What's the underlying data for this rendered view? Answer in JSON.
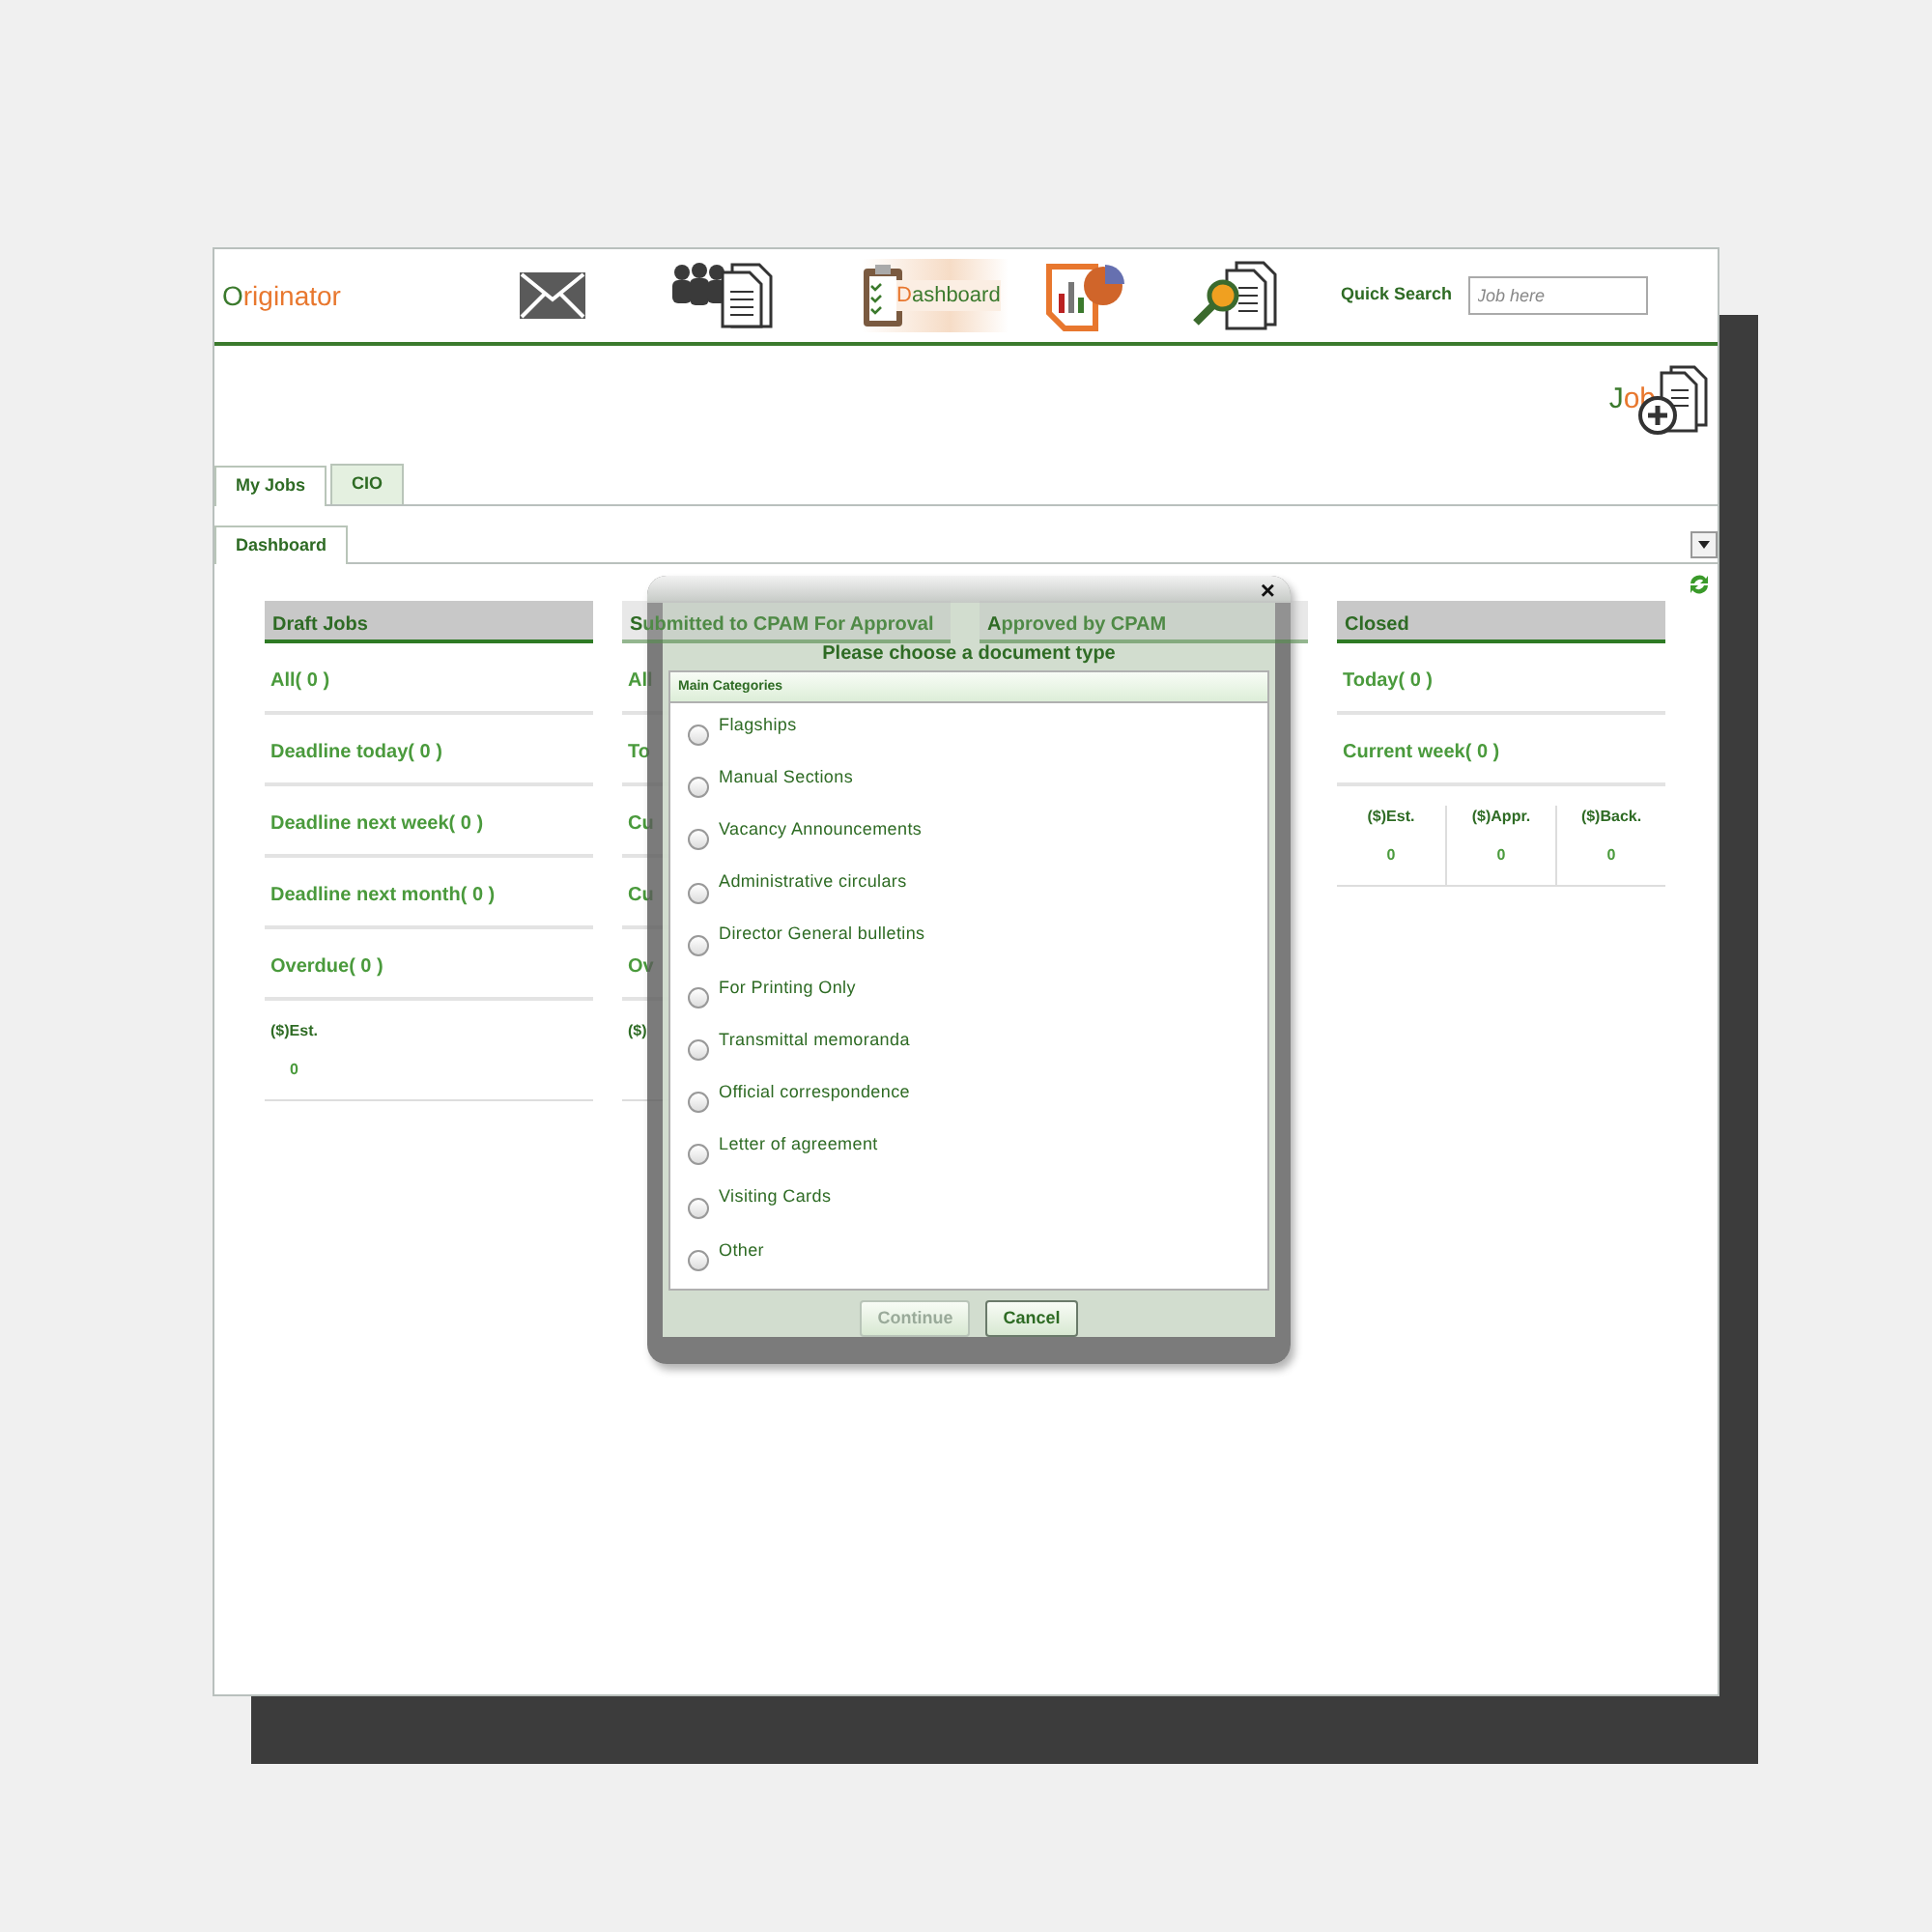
{
  "header": {
    "logo": "Originator",
    "nav": [
      {
        "kind": "mail"
      },
      {
        "kind": "people"
      },
      {
        "kind": "dashboard",
        "label": "Dashboard"
      },
      {
        "kind": "chart"
      },
      {
        "kind": "search"
      }
    ],
    "quick_search": {
      "label": "Quick Search",
      "placeholder": "Job here"
    }
  },
  "new_job": {
    "label": "Job"
  },
  "tabs": [
    {
      "label": "My Jobs",
      "selected": true
    },
    {
      "label": "CIO",
      "selected": false
    }
  ],
  "subtabs": [
    {
      "label": "Dashboard",
      "selected": true
    }
  ],
  "columns": [
    {
      "title": "Draft Jobs",
      "items": [
        "All( 0 )",
        "Deadline today( 0 )",
        "Deadline next week( 0 )",
        "Deadline next month( 0 )",
        "Overdue( 0 )"
      ],
      "stats": [
        {
          "label": "($)Est.",
          "value": "0"
        }
      ]
    },
    {
      "title": "Submitted to CPAM For Approval",
      "items": [
        "All",
        "To",
        "Cu",
        "Cu",
        "Ov"
      ],
      "stats": [
        {
          "label": "($)"
        }
      ]
    },
    {
      "title": "Approved by CPAM"
    },
    {
      "title": "Closed",
      "items": [
        "Today( 0 )",
        "Current week( 0 )"
      ],
      "stats": [
        {
          "label": "($)Est.",
          "value": "0"
        },
        {
          "label": "($)Appr.",
          "value": "0"
        },
        {
          "label": "($)Back.",
          "value": "0"
        }
      ]
    }
  ],
  "dialog": {
    "title": "Please choose a document type",
    "close": "×",
    "group": "Main Categories",
    "options": [
      {
        "label": "Flagships",
        "selected": false
      },
      {
        "label": "Manual Sections",
        "selected": false
      },
      {
        "label": "Vacancy Announcements",
        "selected": false
      },
      {
        "label": "Administrative circulars",
        "selected": false
      },
      {
        "label": "Director General bulletins",
        "selected": false
      },
      {
        "label": "For Printing Only",
        "selected": false
      },
      {
        "label": "Transmittal memoranda",
        "selected": false
      },
      {
        "label": "Official correspondence",
        "selected": false
      },
      {
        "label": "Letter of agreement",
        "selected": false
      },
      {
        "label": "Visiting Cards",
        "selected": false
      },
      {
        "label": "Other",
        "selected": false
      }
    ],
    "buttons": [
      {
        "label": "Continue",
        "disabled": true
      },
      {
        "label": "Cancel",
        "disabled": false
      }
    ]
  }
}
